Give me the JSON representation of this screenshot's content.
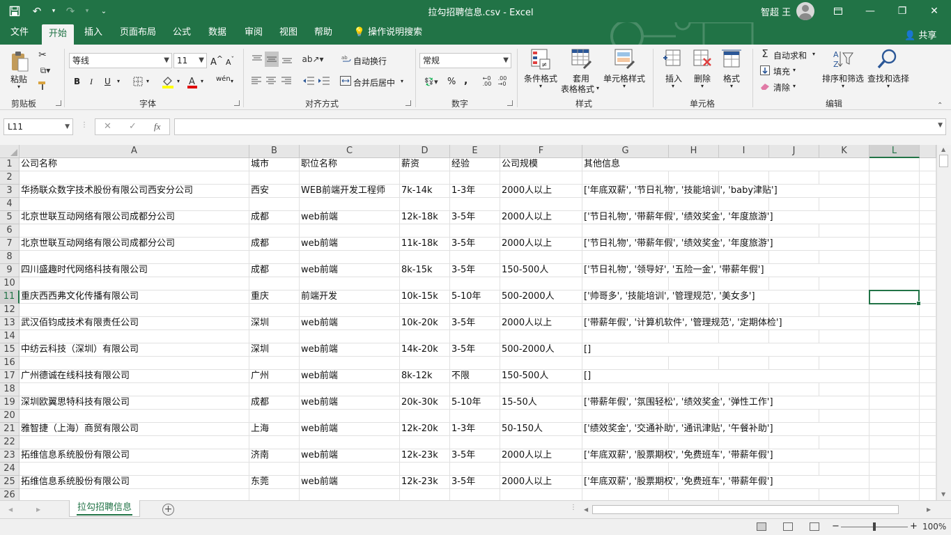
{
  "window": {
    "title": "拉勾招聘信息.csv  -  Excel",
    "user": "智超 王"
  },
  "qat": {
    "save_icon": "save-icon",
    "undo_icon": "undo-icon",
    "redo_icon": "redo-icon"
  },
  "tabs": [
    {
      "label": "文件"
    },
    {
      "label": "开始"
    },
    {
      "label": "插入"
    },
    {
      "label": "页面布局"
    },
    {
      "label": "公式"
    },
    {
      "label": "数据"
    },
    {
      "label": "审阅"
    },
    {
      "label": "视图"
    },
    {
      "label": "帮助"
    },
    {
      "label": "操作说明搜索"
    }
  ],
  "share_label": "共享",
  "ribbon": {
    "clipboard": {
      "paste": "粘贴",
      "group": "剪贴板"
    },
    "font": {
      "name": "等线",
      "size": "11",
      "group": "字体",
      "bold": "B",
      "italic": "I",
      "underline": "U",
      "grow": "A",
      "shrink": "A",
      "wen": "wén"
    },
    "alignment": {
      "wrap": "自动换行",
      "merge": "合并后居中",
      "group": "对齐方式"
    },
    "number": {
      "format": "常规",
      "percent": "%",
      "comma": ",",
      "group": "数字"
    },
    "styles": {
      "cond": "条件格式",
      "table1": "套用",
      "table2": "表格格式",
      "cell": "单元格样式",
      "group": "样式"
    },
    "cells": {
      "insert": "插入",
      "delete": "删除",
      "format": "格式",
      "group": "单元格"
    },
    "editing": {
      "autosum": "自动求和",
      "fill": "填充",
      "clear": "清除",
      "sort": "排序和筛选",
      "find": "查找和选择",
      "group": "编辑"
    }
  },
  "formula_bar": {
    "name_box": "L11",
    "fx": "fx",
    "value": ""
  },
  "columns": [
    "A",
    "B",
    "C",
    "D",
    "E",
    "F",
    "G",
    "H",
    "I",
    "J",
    "K",
    "L"
  ],
  "selected": {
    "col": "L",
    "row": 11
  },
  "rows": [
    [
      "公司名称",
      "城市",
      "职位名称",
      "薪资",
      "经验",
      "公司规模",
      "其他信息"
    ],
    [],
    [
      "华扬联众数字技术股份有限公司西安分公司",
      "西安",
      "WEB前端开发工程师",
      "7k-14k",
      "1-3年",
      "2000人以上",
      "['年底双薪', '节日礼物', '技能培训', 'baby津贴']"
    ],
    [],
    [
      "北京世联互动网络有限公司成都分公司",
      "成都",
      "web前端",
      "12k-18k",
      "3-5年",
      "2000人以上",
      "['节日礼物', '带薪年假', '绩效奖金', '年度旅游']"
    ],
    [],
    [
      "北京世联互动网络有限公司成都分公司",
      "成都",
      "web前端",
      "11k-18k",
      "3-5年",
      "2000人以上",
      "['节日礼物', '带薪年假', '绩效奖金', '年度旅游']"
    ],
    [],
    [
      "四川盛趣时代网络科技有限公司",
      "成都",
      "web前端",
      "8k-15k",
      "3-5年",
      "150-500人",
      "['节日礼物', '领导好', '五险一金', '带薪年假']"
    ],
    [],
    [
      "重庆西西弗文化传播有限公司",
      "重庆",
      "前端开发",
      "10k-15k",
      "5-10年",
      "500-2000人",
      "['帅哥多', '技能培训', '管理规范', '美女多']"
    ],
    [],
    [
      "武汉佰钧成技术有限责任公司",
      "深圳",
      "web前端",
      "10k-20k",
      "3-5年",
      "2000人以上",
      "['带薪年假', '计算机软件', '管理规范', '定期体检']"
    ],
    [],
    [
      "中纺云科技（深圳）有限公司",
      "深圳",
      "web前端",
      "14k-20k",
      "3-5年",
      "500-2000人",
      "[]"
    ],
    [],
    [
      "广州德诚在线科技有限公司",
      "广州",
      "web前端",
      "8k-12k",
      "不限",
      "150-500人",
      "[]"
    ],
    [],
    [
      "深圳欧翼思特科技有限公司",
      "成都",
      "web前端",
      "20k-30k",
      "5-10年",
      "15-50人",
      "['带薪年假', '氛围轻松', '绩效奖金', '弹性工作']"
    ],
    [],
    [
      "雅智捷（上海）商贸有限公司",
      "上海",
      "web前端",
      "12k-20k",
      "1-3年",
      "50-150人",
      "['绩效奖金', '交通补助', '通讯津贴', '午餐补助']"
    ],
    [],
    [
      "拓维信息系统股份有限公司",
      "济南",
      "web前端",
      "12k-23k",
      "3-5年",
      "2000人以上",
      "['年底双薪', '股票期权', '免费班车', '带薪年假']"
    ],
    [],
    [
      "拓维信息系统股份有限公司",
      "东莞",
      "web前端",
      "12k-23k",
      "3-5年",
      "2000人以上",
      "['年底双薪', '股票期权', '免费班车', '带薪年假']"
    ],
    []
  ],
  "sheet_tabs": [
    {
      "label": "拉勾招聘信息"
    }
  ],
  "status": {
    "zoom": "100%",
    "zoom_level_percent": 100
  }
}
